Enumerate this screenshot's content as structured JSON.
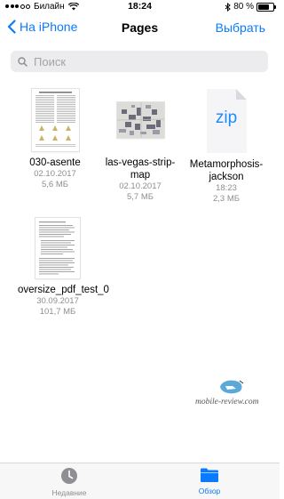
{
  "status": {
    "carrier": "Билайн",
    "time": "18:24",
    "battery": "80 %",
    "battery_level": 0.8
  },
  "nav": {
    "back_label": "На iPhone",
    "title": "Pages",
    "action_label": "Выбрать"
  },
  "search": {
    "placeholder": "Поиск",
    "value": ""
  },
  "files": [
    {
      "name": "030-asente",
      "date": "02.10.2017",
      "size": "5,6 МБ"
    },
    {
      "name": "las-vegas-strip-map",
      "date": "02.10.2017",
      "size": "5,7 МБ"
    },
    {
      "name": "Metamorphosis-jackson",
      "date": "18:23",
      "size": "2,3 МБ",
      "badge": "zip"
    },
    {
      "name": "oversize_pdf_test_0",
      "date": "30.09.2017",
      "size": "101,7 МБ"
    }
  ],
  "watermark": "mobile-review.com",
  "tabs": [
    {
      "label": "Недавние",
      "icon": "clock-icon",
      "active": false
    },
    {
      "label": "Обзор",
      "icon": "folder-icon",
      "active": true
    }
  ],
  "colors": {
    "accent": "#0a7aff",
    "inactive": "#8e8e93"
  }
}
